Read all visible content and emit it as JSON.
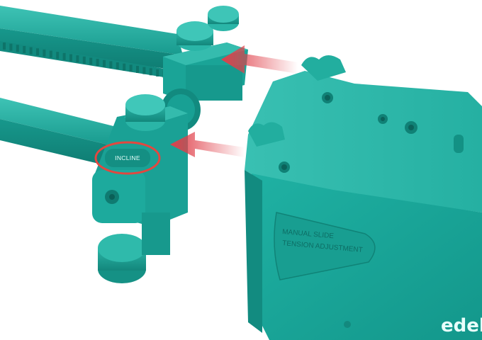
{
  "image": {
    "description_labels": {
      "incline_label": "INCLINE",
      "tension_line_1": "MANUAL SLIDE",
      "tension_line_2": "TENSION ADJUSTMENT",
      "brand": "edel"
    },
    "colors": {
      "body": "#1aa89b",
      "body_dark": "#12857a",
      "body_light": "#3cc2b4",
      "arrow": "#e0404a",
      "highlight_ring": "#e3473f"
    }
  }
}
